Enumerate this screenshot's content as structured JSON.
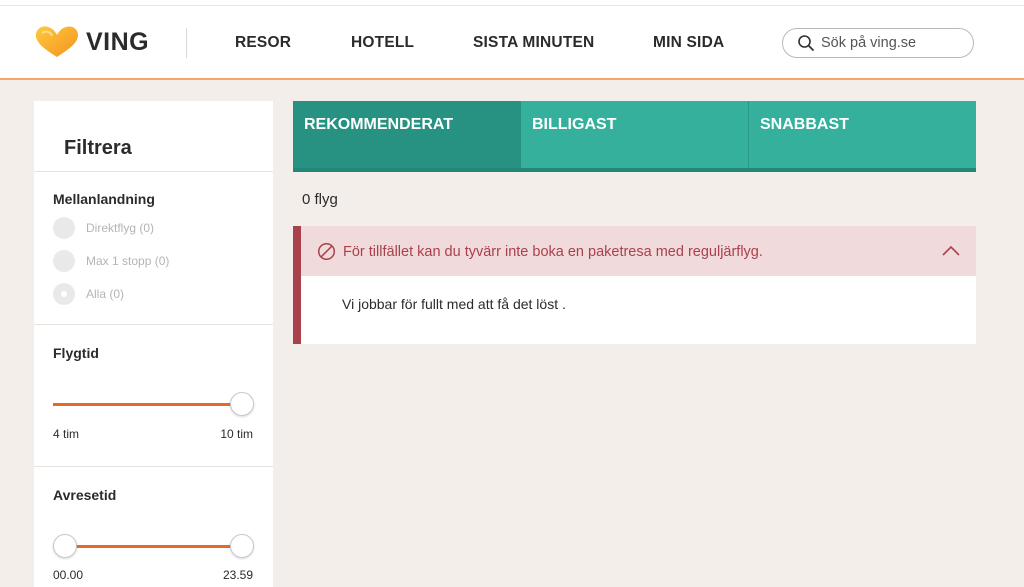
{
  "brand": {
    "name": "VING",
    "colors": {
      "orange": "#f5a23c",
      "teal": "#34b09c",
      "teal_active": "#279282",
      "alert_red": "#a9414c",
      "slider": "#e46a25"
    }
  },
  "nav": {
    "items": [
      "RESOR",
      "HOTELL",
      "SISTA MINUTEN",
      "MIN SIDA"
    ]
  },
  "search": {
    "placeholder": "Sök på ving.se",
    "icon": "search-icon"
  },
  "sidebar": {
    "title": "Filtrera",
    "stopover": {
      "title": "Mellanlandning",
      "options": [
        {
          "label": "Direktflyg (0)",
          "selected": false
        },
        {
          "label": "Max 1 stopp (0)",
          "selected": false
        },
        {
          "label": "Alla (0)",
          "selected": true
        }
      ]
    },
    "flight_time": {
      "title": "Flygtid",
      "min_label": "4 tim",
      "max_label": "10 tim",
      "value_fraction": 1.0
    },
    "departure_time": {
      "title": "Avresetid",
      "min_label": "00.00",
      "max_label": "23.59",
      "range_fraction": [
        0.0,
        1.0
      ]
    }
  },
  "tabs": [
    {
      "label": "REKOMMENDERAT",
      "active": true
    },
    {
      "label": "BILLIGAST",
      "active": false
    },
    {
      "label": "SNABBAST",
      "active": false
    }
  ],
  "results": {
    "count_text": "0 flyg"
  },
  "alert": {
    "icon": "ban-icon",
    "title": "För tillfället kan du tyvärr inte boka en paketresa med reguljärflyg.",
    "body": "Vi jobbar för fullt med att få det löst .",
    "toggle_icon": "chevron-up-icon"
  }
}
